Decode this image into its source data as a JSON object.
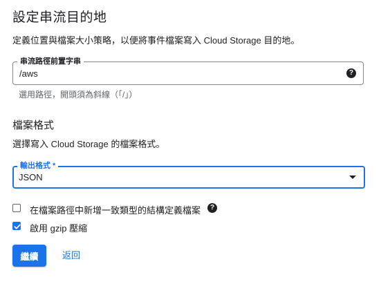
{
  "page": {
    "title": "設定串流目的地",
    "description": "定義位置與檔案大小策略，以便將事件檔案寫入 Cloud Storage 目的地。"
  },
  "prefix_field": {
    "label": "串流路徑前置字串",
    "value": "/aws",
    "help_icon": "help-icon",
    "hint": "選用路徑，開頭須為斜線（「/」）"
  },
  "file_format": {
    "heading": "檔案格式",
    "description": "選擇寫入 Cloud Storage 的檔案格式。",
    "select_label": "輸出格式 *",
    "selected_value": "JSON"
  },
  "options": {
    "schema_file": {
      "label": "在檔案路徑中新增一致類型的結構定義檔案",
      "checked": false,
      "help_icon": "help-icon"
    },
    "gzip": {
      "label": "啟用 gzip 壓縮",
      "checked": true
    }
  },
  "actions": {
    "continue_label": "繼續",
    "back_label": "返回"
  },
  "colors": {
    "accent": "#1a73e8",
    "text": "#202124",
    "hint": "#5f6368"
  }
}
